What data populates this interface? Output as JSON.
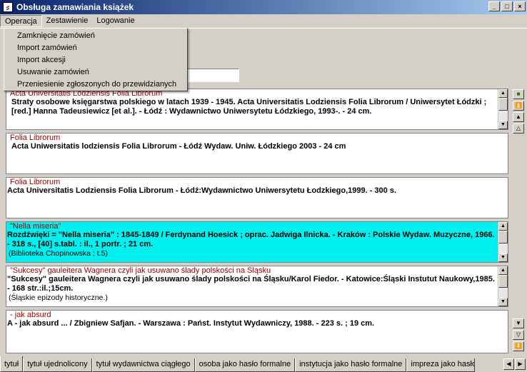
{
  "window": {
    "title": "Obsługa zamawiania książek",
    "icon": "app-icon",
    "buttons": [
      "_",
      "□",
      "×"
    ]
  },
  "menubar": [
    {
      "label": "Operacja"
    },
    {
      "label": "Zestawienie"
    },
    {
      "label": "Logowanie"
    }
  ],
  "dropdown": [
    "Zamknięcie zamówień",
    "Import zamówień",
    "Import akcesji",
    "Usuwanie zamówień",
    "Przeniesienie zgłoszonych do przewidzianych"
  ],
  "search": {
    "value": ""
  },
  "records": [
    {
      "head": "Acta Universitatis Lodziensis Folia Librorum",
      "body": "Straty osobowe księgarstwa polskiego w latach 1939 - 1945. Acta Universitatis Lodziensis Folia Librorum / Uniwersytet Łódzki ; [red.] Hanna Tadeusiewicz [et al.]. -  Łódź :  Wydawnictwo Uniwersytetu Łódzkiego,  1993-. -  24 cm.",
      "series": ""
    },
    {
      "head": "Folia Librorum",
      "body": "Acta Uniwersitatis lodziensis  Folia Librorum -  Łódź Wydaw. Uniw. Łódzkiego 2003 -  24 cm",
      "series": ""
    },
    {
      "head": "Folia Librorum",
      "body": "Acta Universitatis Lodziensis  Folia Librorum - Łódź:Wydawnictwo Uniwersytetu Łodzkiego,1999. - 300 s.",
      "series": ""
    },
    {
      "head": "\"Nella miseria\"",
      "body": "Rozdźwięki = \"Nella miseria\" : 1845-1849 / Ferdynand Hoesick ; oprac. Jadwiga Ilnicka. - Kraków : Polskie Wydaw. Muzyczne, 1966. - 318 s., [40] s.tabl. : il., 1 portr. ; 21 cm.",
      "series": "(Biblioteka Chopinowska ; t.5)"
    },
    {
      "head": "\"Sukcesy\" gauleitera Wagnera czyli jak usuwano ślady polskości na Śląsku",
      "body": "\"Sukcesy\" gauleitera Wagnera czyli jak usuwano ślady polskości na Śląsku/Karol Fiedor. - Katowice:Śląski Instutut Naukowy,1985. - 168 str.:il.;15cm.",
      "series": "(Śląskie epizody historyczne.)"
    },
    {
      "head": "- jak absurd",
      "body": "A - jak absurd ... / Zbigniew Safjan. - Warszawa : Państ. Instytut Wydawniczy, 1988. - 223 s. ; 19 cm.",
      "series": ""
    }
  ],
  "tabs": [
    "tytuł",
    "tytuł ujednolicony",
    "tytuł wydawnictwa ciągłego",
    "osoba jako hasło formalne",
    "instytucja jako hasło formalne",
    "impreza jako hasło formalne"
  ],
  "icons": {
    "nav_top": [
      "stop-icon",
      "first-record-icon",
      "previous-page-icon",
      "previous-record-icon"
    ],
    "nav_bottom": [
      "next-record-icon",
      "next-page-icon",
      "last-record-icon"
    ]
  }
}
